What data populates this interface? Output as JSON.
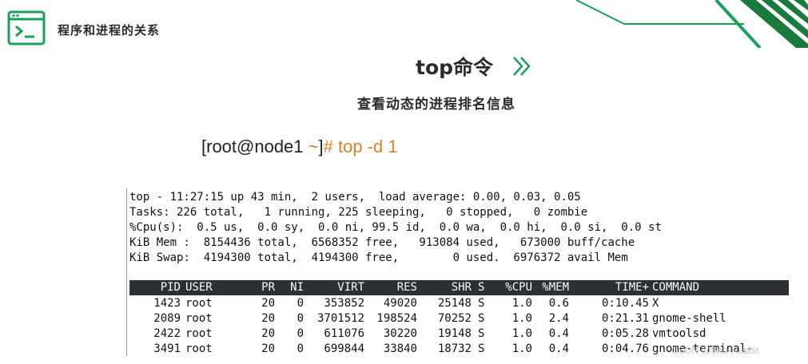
{
  "header": {
    "title": "程序和进程的关系",
    "icon": "terminal-icon"
  },
  "slide": {
    "main_title": "top命令",
    "subtitle": "查看动态的进程排名信息"
  },
  "command": {
    "prefix": "[root@node1 ",
    "tilde": "~",
    "bracket": "]",
    "hash": "# top -d 1"
  },
  "summary": [
    "top - 11:27:15 up 43 min,  2 users,  load average: 0.00, 0.03, 0.05",
    "Tasks: 226 total,   1 running, 225 sleeping,   0 stopped,   0 zombie",
    "%Cpu(s):  0.5 us,  0.0 sy,  0.0 ni, 99.5 id,  0.0 wa,  0.0 hi,  0.0 si,  0.0 st",
    "KiB Mem :  8154436 total,  6568352 free,   913084 used,   673000 buff/cache",
    "KiB Swap:  4194300 total,  4194300 free,        0 used.  6976372 avail Mem"
  ],
  "process_table": {
    "headers": [
      "PID",
      "USER",
      "PR",
      "NI",
      "VIRT",
      "RES",
      "SHR",
      "S",
      "%CPU",
      "%MEM",
      "TIME+",
      "COMMAND"
    ],
    "rows": [
      [
        "1423",
        "root",
        "20",
        "0",
        "353852",
        "49020",
        "25148",
        "S",
        "1.0",
        "0.6",
        "0:10.45",
        "X"
      ],
      [
        "2089",
        "root",
        "20",
        "0",
        "3701512",
        "198524",
        "70252",
        "S",
        "1.0",
        "2.4",
        "0:21.31",
        "gnome-shell"
      ],
      [
        "2422",
        "root",
        "20",
        "0",
        "611076",
        "30220",
        "19148",
        "S",
        "1.0",
        "0.4",
        "0:05.28",
        "vmtoolsd"
      ],
      [
        "3491",
        "root",
        "20",
        "0",
        "699844",
        "33840",
        "18732",
        "S",
        "1.0",
        "0.4",
        "0:04.76",
        "gnome-terminal-"
      ]
    ]
  },
  "watermark": "CSDN @Sad-Rabbit",
  "colors": {
    "accent_green": "#1aa05a",
    "tilde": "#d27a3a",
    "header_bg": "#2c3033"
  }
}
